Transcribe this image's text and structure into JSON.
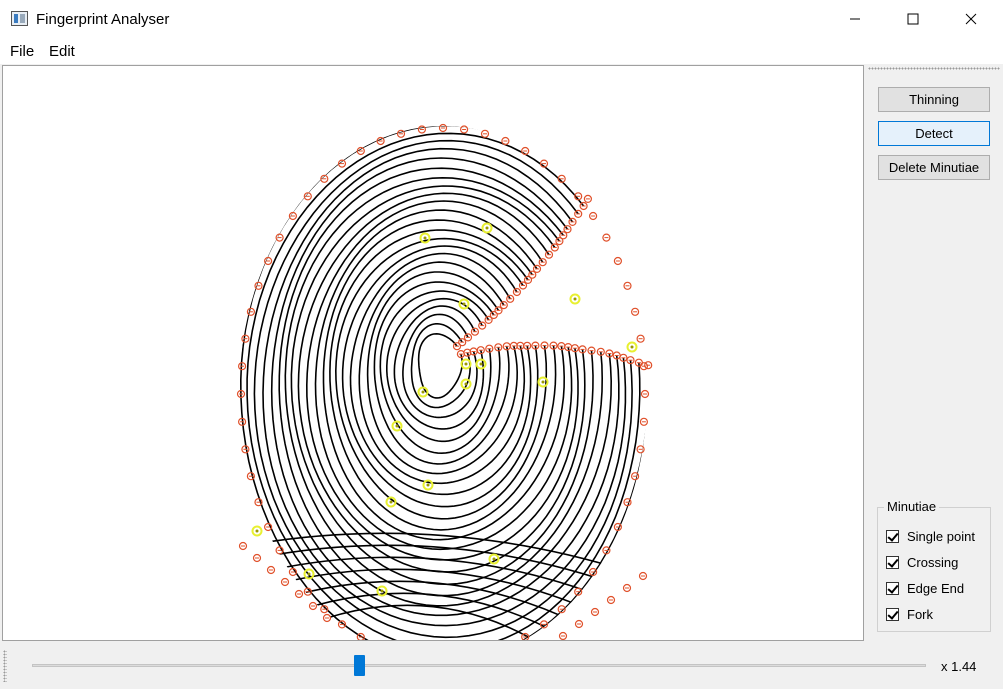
{
  "window": {
    "title": "Fingerprint Analyser",
    "icon": "fingerprint-app-icon"
  },
  "menu": [
    "File",
    "Edit"
  ],
  "buttons": {
    "thinning": "Thinning",
    "detect": "Detect",
    "delete": "Delete Minutiae"
  },
  "minutiae": {
    "title": "Minutiae",
    "options": [
      {
        "label": "Single point",
        "checked": true
      },
      {
        "label": "Crossing",
        "checked": true
      },
      {
        "label": "Edge End",
        "checked": true
      },
      {
        "label": "Fork",
        "checked": true
      }
    ]
  },
  "zoom": {
    "label": "x 1.44",
    "slider_fraction": 0.365
  },
  "colors": {
    "ending_marker": "#e0502a",
    "fork_marker": "#e8f030",
    "accent": "#0078d7"
  }
}
